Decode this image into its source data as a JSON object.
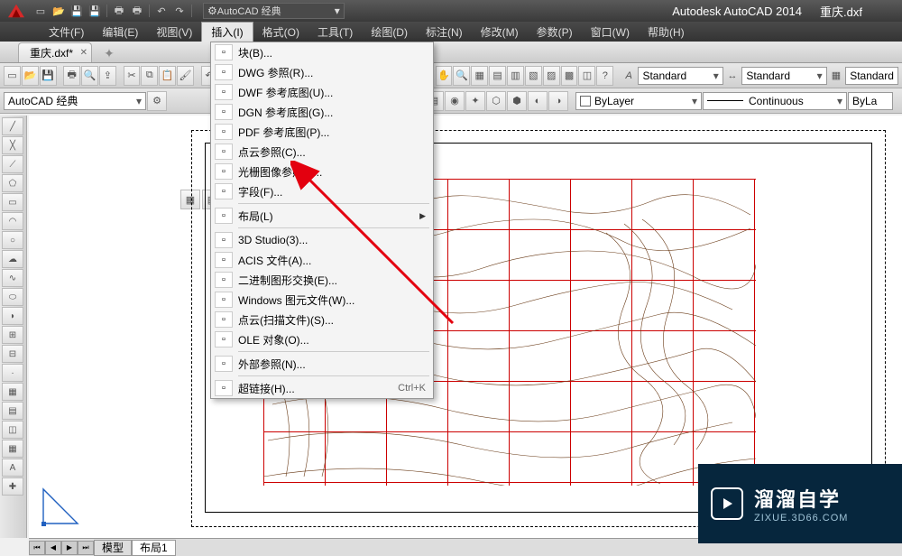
{
  "app": {
    "title": "Autodesk AutoCAD 2014",
    "open_file": "重庆.dxf",
    "workspace_label": "AutoCAD 经典"
  },
  "menu": {
    "items": [
      "文件(F)",
      "编辑(E)",
      "视图(V)",
      "插入(I)",
      "格式(O)",
      "工具(T)",
      "绘图(D)",
      "标注(N)",
      "修改(M)",
      "参数(P)",
      "窗口(W)",
      "帮助(H)"
    ],
    "active_index": 3
  },
  "doc_tab": {
    "label": "重庆.dxf*"
  },
  "workspace_combo": {
    "value": "AutoCAD 经典"
  },
  "styles": {
    "text_style": "Standard",
    "dim_style": "Standard",
    "table_style": "Standard"
  },
  "layers": {
    "color_label": "ByLayer",
    "linetype": "Continuous",
    "lineweight": "ByLa"
  },
  "layout_tabs": {
    "model": "模型",
    "layout1": "布局1"
  },
  "dropdown": {
    "items": [
      {
        "label": "块(B)...",
        "icon": "block"
      },
      {
        "label": "DWG 参照(R)...",
        "icon": "dwg"
      },
      {
        "label": "DWF 参考底图(U)...",
        "icon": "dwf"
      },
      {
        "label": "DGN 参考底图(G)...",
        "icon": "dgn"
      },
      {
        "label": "PDF 参考底图(P)...",
        "icon": "pdf"
      },
      {
        "label": "点云参照(C)...",
        "icon": "pcloud"
      },
      {
        "label": "光栅图像参照(I)...",
        "icon": "raster",
        "highlight": true
      },
      {
        "label": "字段(F)...",
        "icon": "field"
      },
      {
        "sep": true
      },
      {
        "label": "布局(L)",
        "icon": "",
        "submenu": true
      },
      {
        "sep": true
      },
      {
        "label": "3D Studio(3)...",
        "icon": "3ds"
      },
      {
        "label": "ACIS 文件(A)...",
        "icon": "acis"
      },
      {
        "label": "二进制图形交换(E)...",
        "icon": "bin"
      },
      {
        "label": "Windows 图元文件(W)...",
        "icon": "wmf"
      },
      {
        "label": "点云(扫描文件)(S)...",
        "icon": "scan"
      },
      {
        "label": "OLE 对象(O)...",
        "icon": "ole"
      },
      {
        "sep": true
      },
      {
        "label": "外部参照(N)...",
        "icon": "xref"
      },
      {
        "sep": true
      },
      {
        "label": "超链接(H)...",
        "icon": "link",
        "shortcut": "Ctrl+K"
      }
    ]
  },
  "watermark": {
    "name_cn": "溜溜自学",
    "url": "ZIXUE.3D66.COM"
  }
}
